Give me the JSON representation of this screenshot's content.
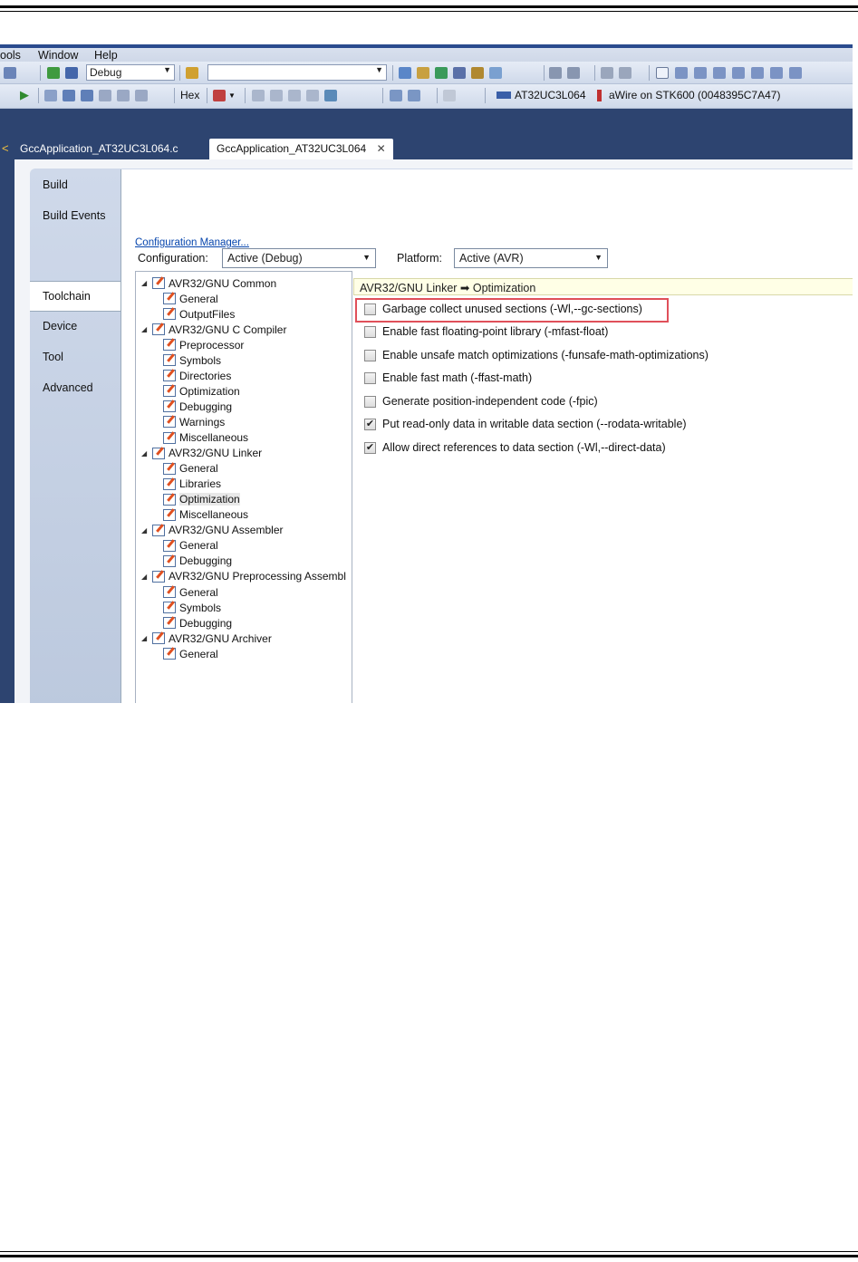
{
  "menu": [
    "ools",
    "Window",
    "Help"
  ],
  "toolbar1": {
    "config_combo": "Debug",
    "search_combo": ""
  },
  "toolbar2": {
    "hex_label": "Hex",
    "device_label": "AT32UC3L064",
    "tool_label": "aWire on STK600 (0048395C7A47)"
  },
  "doc_tabs": {
    "tab1": "GccApplication_AT32UC3L064.c",
    "tab2": "GccApplication_AT32UC3L064",
    "close_glyph": "✕"
  },
  "side_tabs": [
    "Build",
    "Build Events",
    "Toolchain",
    "Device",
    "Tool",
    "Advanced"
  ],
  "active_side_tab": "Toolchain",
  "configuration": {
    "label": "Configuration:",
    "value": "Active (Debug)",
    "platform_label": "Platform:",
    "platform_value": "Active (AVR)",
    "manager_link": "Configuration Manager..."
  },
  "tree": [
    {
      "label": "AVR32/GNU Common",
      "level": 0
    },
    {
      "label": "General",
      "level": 1
    },
    {
      "label": "OutputFiles",
      "level": 1
    },
    {
      "label": "AVR32/GNU C Compiler",
      "level": 0
    },
    {
      "label": "Preprocessor",
      "level": 1
    },
    {
      "label": "Symbols",
      "level": 1
    },
    {
      "label": "Directories",
      "level": 1
    },
    {
      "label": "Optimization",
      "level": 1
    },
    {
      "label": "Debugging",
      "level": 1
    },
    {
      "label": "Warnings",
      "level": 1
    },
    {
      "label": "Miscellaneous",
      "level": 1
    },
    {
      "label": "AVR32/GNU Linker",
      "level": 0
    },
    {
      "label": "General",
      "level": 1
    },
    {
      "label": "Libraries",
      "level": 1
    },
    {
      "label": "Optimization",
      "level": 1,
      "selected": true
    },
    {
      "label": "Miscellaneous",
      "level": 1
    },
    {
      "label": "AVR32/GNU Assembler",
      "level": 0
    },
    {
      "label": "General",
      "level": 1
    },
    {
      "label": "Debugging",
      "level": 1
    },
    {
      "label": "AVR32/GNU Preprocessing Assembl",
      "level": 0
    },
    {
      "label": "General",
      "level": 1
    },
    {
      "label": "Symbols",
      "level": 1
    },
    {
      "label": "Debugging",
      "level": 1
    },
    {
      "label": "AVR32/GNU Archiver",
      "level": 0
    },
    {
      "label": "General",
      "level": 1
    }
  ],
  "panel_header": "AVR32/GNU Linker ➡ Optimization",
  "options": [
    {
      "label": "Garbage collect unused sections (-Wl,--gc-sections)",
      "checked": false,
      "highlighted": true
    },
    {
      "label": "Enable fast floating-point library (-mfast-float)",
      "checked": false
    },
    {
      "label": "Enable unsafe match optimizations (-funsafe-math-optimizations)",
      "checked": false
    },
    {
      "label": "Enable fast math (-ffast-math)",
      "checked": false
    },
    {
      "label": "Generate position-independent code (-fpic)",
      "checked": false
    },
    {
      "label": "Put read-only data in writable data section (--rodata-writable)",
      "checked": true
    },
    {
      "label": "Allow direct references to data section (-Wl,--direct-data)",
      "checked": true
    }
  ],
  "colors": {
    "highlight_box": "#e0505a",
    "link": "#0645ad",
    "header_bg": "#ffffe6"
  }
}
